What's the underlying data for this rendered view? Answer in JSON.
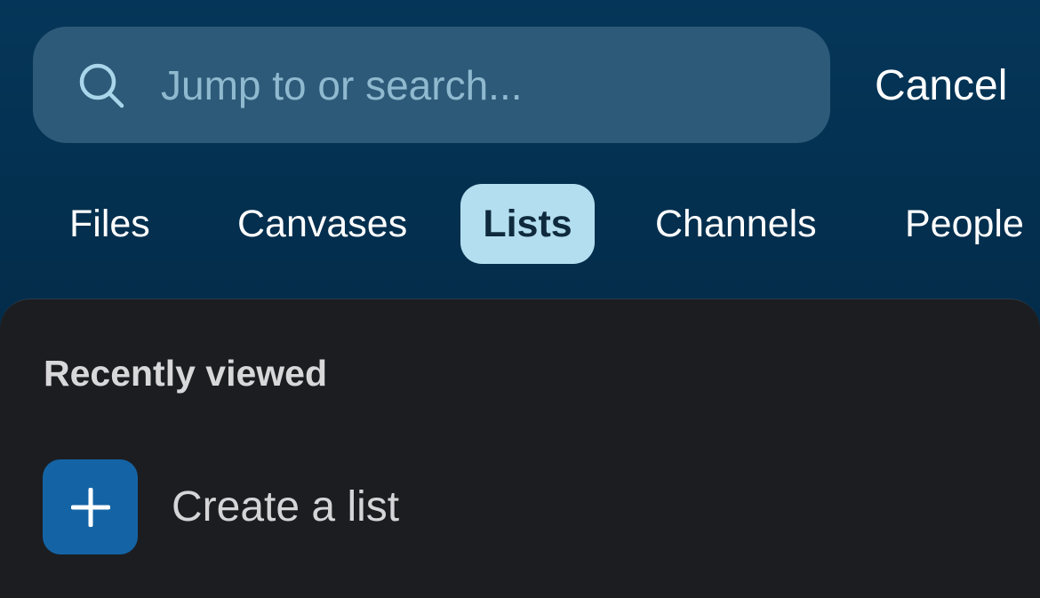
{
  "search": {
    "placeholder": "Jump to or search...",
    "value": "",
    "icon": "search-icon",
    "cancel_label": "Cancel"
  },
  "tabs": [
    {
      "label": "Files",
      "active": false
    },
    {
      "label": "Canvases",
      "active": false
    },
    {
      "label": "Lists",
      "active": true
    },
    {
      "label": "Channels",
      "active": false
    },
    {
      "label": "People",
      "active": false
    }
  ],
  "panel": {
    "section_title": "Recently viewed",
    "create_label": "Create a list",
    "create_icon": "plus-icon"
  },
  "colors": {
    "accent": "#1464a5",
    "active_tab": "#b3deef"
  }
}
